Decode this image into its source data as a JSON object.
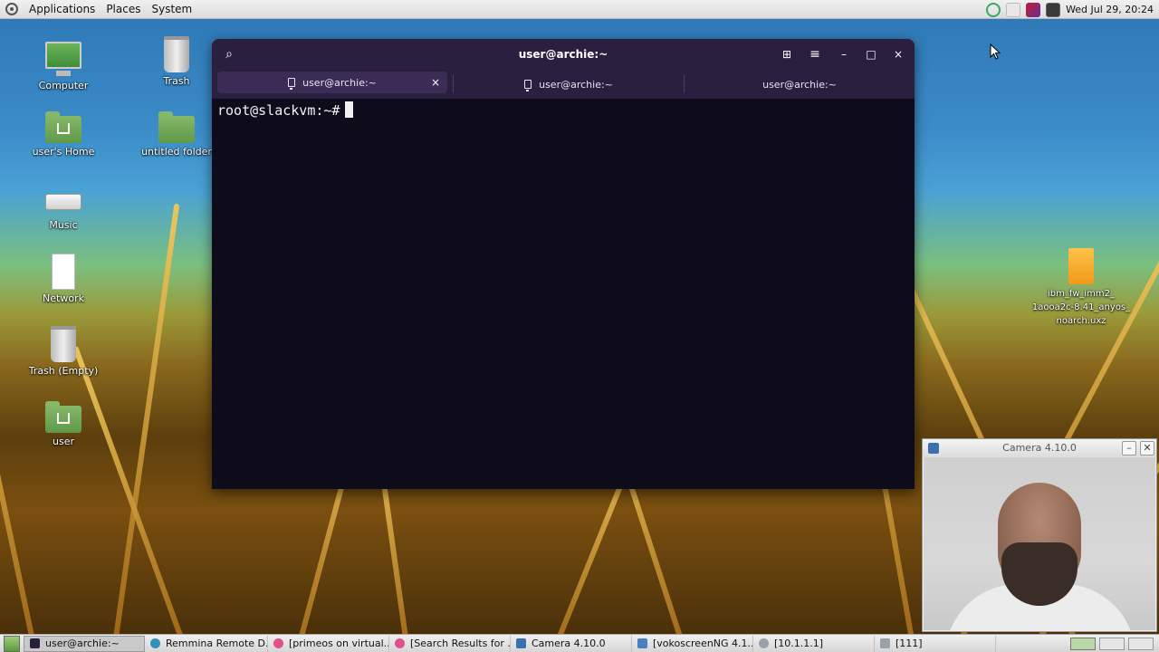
{
  "top_panel": {
    "menus": [
      "Applications",
      "Places",
      "System"
    ],
    "clock": "Wed Jul 29, 20:24"
  },
  "desktop_icons": [
    {
      "label": "Computer",
      "icon": "computer-icon"
    },
    {
      "label": "Trash",
      "icon": "trash-icon"
    },
    {
      "label": "user's Home",
      "icon": "home-folder-icon"
    },
    {
      "label": "untitled folder",
      "icon": "folder-icon"
    },
    {
      "label": "Music",
      "icon": "drive-icon"
    },
    {
      "label": "Network",
      "icon": "document-icon"
    },
    {
      "label": "Trash (Empty)",
      "icon": "trash-icon"
    },
    {
      "label": "user",
      "icon": "home-folder-icon"
    },
    {
      "label": "ibm_fw_imm2_\n1aooa2c-8.41_anyos_\nnoarch.uxz",
      "icon": "archive-icon"
    }
  ],
  "terminal": {
    "title": "user@archie:~",
    "tabs": [
      {
        "label": "user@archie:~",
        "active": true
      },
      {
        "label": "user@archie:~",
        "active": false
      },
      {
        "label": "user@archie:~",
        "active": false
      }
    ],
    "prompt": "root@slackvm:~#",
    "close_glyph": "×",
    "new_tab_glyph": "⊞",
    "menu_glyph": "≡",
    "minimize_glyph": "–",
    "maximize_glyph": "□",
    "search_glyph": "⌕"
  },
  "camera_window": {
    "title": "Camera 4.10.0",
    "minimize_glyph": "–",
    "close_glyph": "✕"
  },
  "taskbar": {
    "tasks": [
      {
        "label": "user@archie:~",
        "active": true,
        "color": "#2b1f40"
      },
      {
        "label": "Remmina Remote D...",
        "active": false,
        "color": "#2f8fbf"
      },
      {
        "label": "[primeos on virtual...",
        "active": false,
        "color": "#e0508a"
      },
      {
        "label": "[Search Results for ...",
        "active": false,
        "color": "#e0508a"
      },
      {
        "label": "Camera 4.10.0",
        "active": false,
        "color": "#3a6fb0"
      },
      {
        "label": "[vokoscreenNG 4.1...",
        "active": false,
        "color": "#4a7fc0"
      },
      {
        "label": "[10.1.1.1]",
        "active": false,
        "color": "#9aa0a8"
      },
      {
        "label": "[111]",
        "active": false,
        "color": "#9aa0a8"
      }
    ]
  }
}
